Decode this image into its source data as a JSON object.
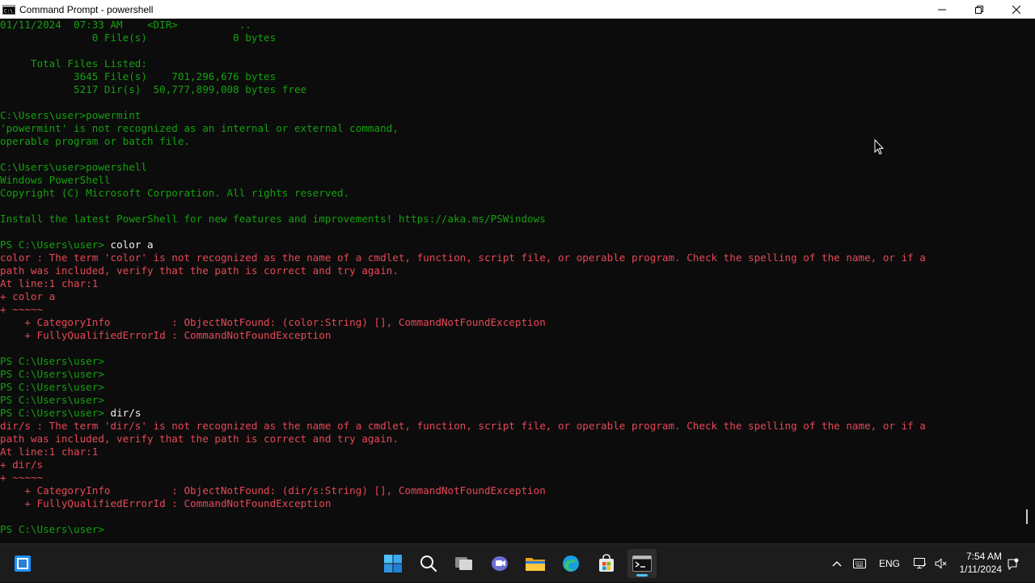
{
  "window": {
    "title": "Command Prompt - powershell",
    "controls": [
      "minimize",
      "restore",
      "close"
    ]
  },
  "console": {
    "lines": [
      {
        "type": "out",
        "text": "01/11/2024  07:33 AM    <DIR>          .."
      },
      {
        "type": "out",
        "text": "               0 File(s)              0 bytes"
      },
      {
        "type": "out",
        "text": ""
      },
      {
        "type": "out",
        "text": "     Total Files Listed:"
      },
      {
        "type": "out",
        "text": "            3645 File(s)    701,296,676 bytes"
      },
      {
        "type": "out",
        "text": "            5217 Dir(s)  50,777,899,008 bytes free"
      },
      {
        "type": "out",
        "text": ""
      },
      {
        "type": "out",
        "text": "C:\\Users\\user>powermint"
      },
      {
        "type": "out",
        "text": "'powermint' is not recognized as an internal or external command,"
      },
      {
        "type": "out",
        "text": "operable program or batch file."
      },
      {
        "type": "out",
        "text": ""
      },
      {
        "type": "out",
        "text": "C:\\Users\\user>powershell"
      },
      {
        "type": "out",
        "text": "Windows PowerShell"
      },
      {
        "type": "out",
        "text": "Copyright (C) Microsoft Corporation. All rights reserved."
      },
      {
        "type": "out",
        "text": ""
      },
      {
        "type": "out",
        "text": "Install the latest PowerShell for new features and improvements! https://aka.ms/PSWindows"
      },
      {
        "type": "out",
        "text": ""
      },
      {
        "type": "ps",
        "prompt": "PS C:\\Users\\user> ",
        "typed": "color a"
      },
      {
        "type": "err",
        "text": "color : The term 'color' is not recognized as the name of a cmdlet, function, script file, or operable program. Check the spelling of the name, or if a"
      },
      {
        "type": "err",
        "text": "path was included, verify that the path is correct and try again."
      },
      {
        "type": "err",
        "text": "At line:1 char:1"
      },
      {
        "type": "err",
        "text": "+ color a"
      },
      {
        "type": "err",
        "text": "+ ~~~~~"
      },
      {
        "type": "err",
        "text": "    + CategoryInfo          : ObjectNotFound: (color:String) [], CommandNotFoundException"
      },
      {
        "type": "err",
        "text": "    + FullyQualifiedErrorId : CommandNotFoundException"
      },
      {
        "type": "out",
        "text": ""
      },
      {
        "type": "ps",
        "prompt": "PS C:\\Users\\user>",
        "typed": ""
      },
      {
        "type": "ps",
        "prompt": "PS C:\\Users\\user>",
        "typed": ""
      },
      {
        "type": "ps",
        "prompt": "PS C:\\Users\\user>",
        "typed": ""
      },
      {
        "type": "ps",
        "prompt": "PS C:\\Users\\user>",
        "typed": ""
      },
      {
        "type": "ps",
        "prompt": "PS C:\\Users\\user> ",
        "typed": "dir/s"
      },
      {
        "type": "err",
        "text": "dir/s : The term 'dir/s' is not recognized as the name of a cmdlet, function, script file, or operable program. Check the spelling of the name, or if a"
      },
      {
        "type": "err",
        "text": "path was included, verify that the path is correct and try again."
      },
      {
        "type": "err",
        "text": "At line:1 char:1"
      },
      {
        "type": "err",
        "text": "+ dir/s"
      },
      {
        "type": "err",
        "text": "+ ~~~~~"
      },
      {
        "type": "err",
        "text": "    + CategoryInfo          : ObjectNotFound: (dir/s:String) [], CommandNotFoundException"
      },
      {
        "type": "err",
        "text": "    + FullyQualifiedErrorId : CommandNotFoundException"
      },
      {
        "type": "out",
        "text": ""
      },
      {
        "type": "ps",
        "prompt": "PS C:\\Users\\user>",
        "typed": ""
      }
    ]
  },
  "taskbar": {
    "apps": [
      {
        "name": "windows-start-icon"
      },
      {
        "name": "search-icon"
      },
      {
        "name": "task-view-icon"
      },
      {
        "name": "teams-chat-icon"
      },
      {
        "name": "file-explorer-icon"
      },
      {
        "name": "edge-browser-icon"
      },
      {
        "name": "microsoft-store-icon"
      },
      {
        "name": "terminal-icon",
        "active": true
      }
    ],
    "tray": {
      "language": "ENG",
      "time": "7:54 AM",
      "date": "1/11/2024"
    }
  },
  "colors": {
    "console_bg": "#0c0c0c",
    "stdout": "#13a10e",
    "stderr": "#e74856",
    "typed": "#f2f2f2",
    "taskbar_bg": "#1c1c1c",
    "accent": "#4cc2ff"
  }
}
